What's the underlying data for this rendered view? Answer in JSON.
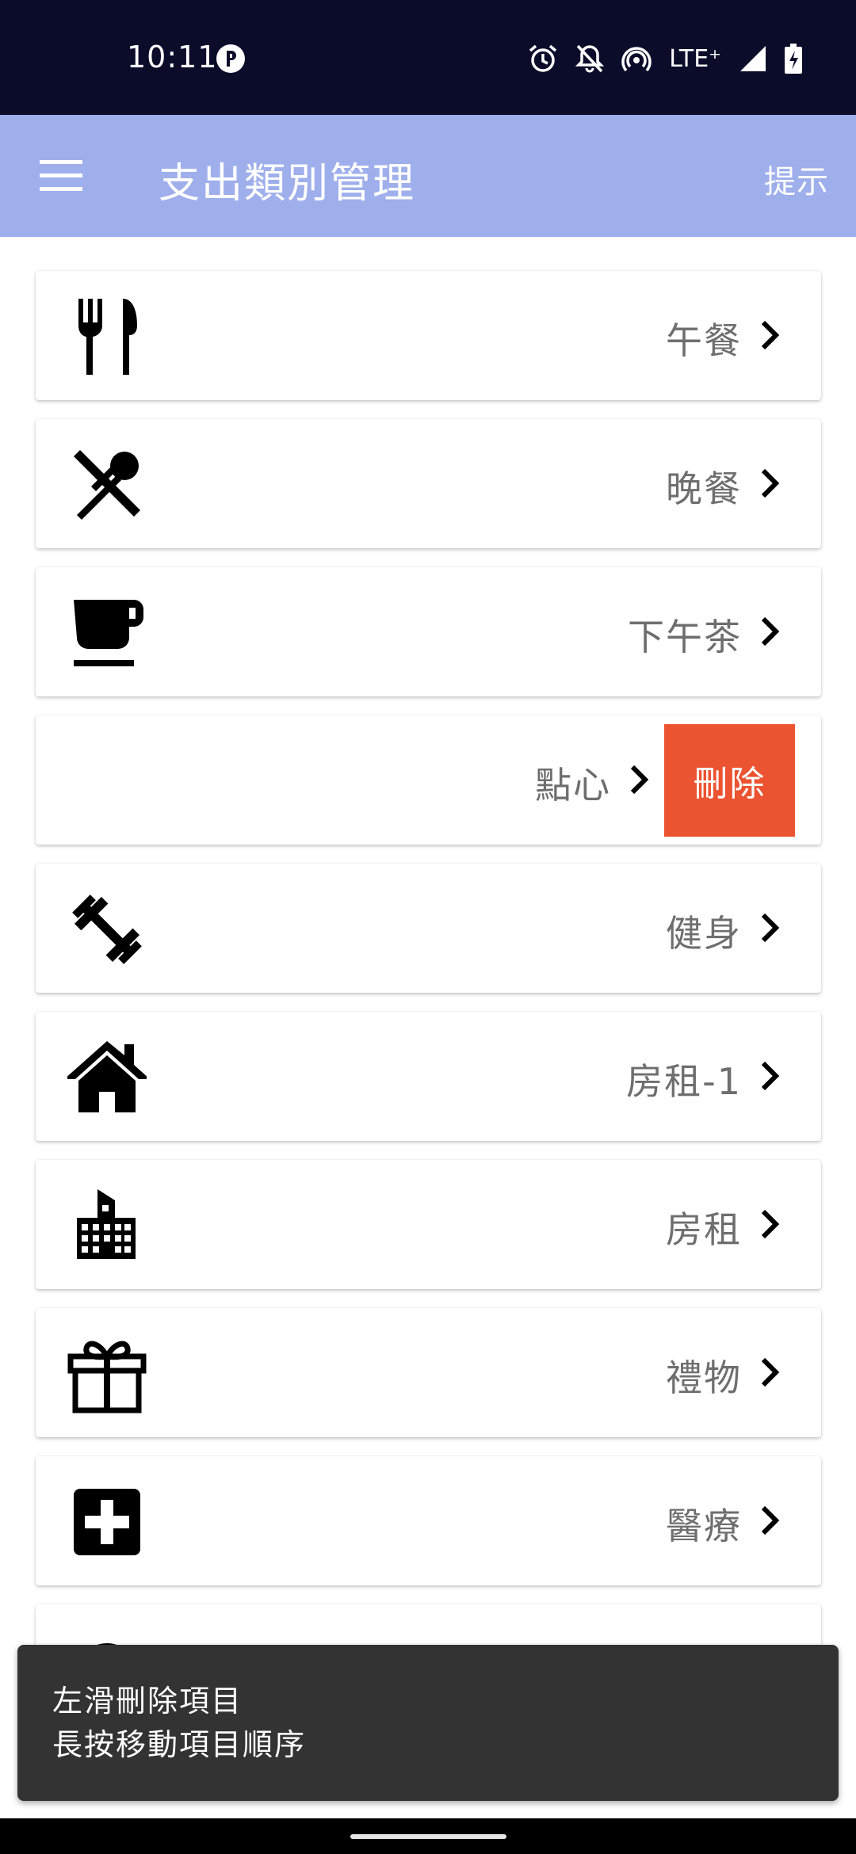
{
  "status_bar": {
    "time": "10:11",
    "network": "LTE⁺",
    "icons": [
      "alarm-icon",
      "notifications-off-icon",
      "hotspot-icon",
      "signal-icon",
      "battery-charging-icon"
    ]
  },
  "app_bar": {
    "title": "支出類別管理",
    "hint_label": "提示",
    "menu_icon": "hamburger-menu-icon"
  },
  "categories": [
    {
      "label": "午餐",
      "icon": "fork-knife-icon"
    },
    {
      "label": "晚餐",
      "icon": "crossed-fork-spoon-icon"
    },
    {
      "label": "下午茶",
      "icon": "coffee-cup-icon"
    },
    {
      "label": "點心",
      "icon": "",
      "swiped": true,
      "delete_label": "刪除"
    },
    {
      "label": "健身",
      "icon": "dumbbell-icon"
    },
    {
      "label": "房租-1",
      "icon": "house-icon"
    },
    {
      "label": "房租",
      "icon": "apartment-building-icon"
    },
    {
      "label": "禮物",
      "icon": "gift-icon"
    },
    {
      "label": "醫療",
      "icon": "medical-cross-icon"
    }
  ],
  "snackbar": {
    "line1": "左滑刪除項目",
    "line2": "長按移動項目順序"
  },
  "colors": {
    "status_bar": "#0b0c2a",
    "app_bar": "#9fafec",
    "delete": "#ec5330",
    "label": "#6e6e6e",
    "snackbar": "#333333"
  }
}
